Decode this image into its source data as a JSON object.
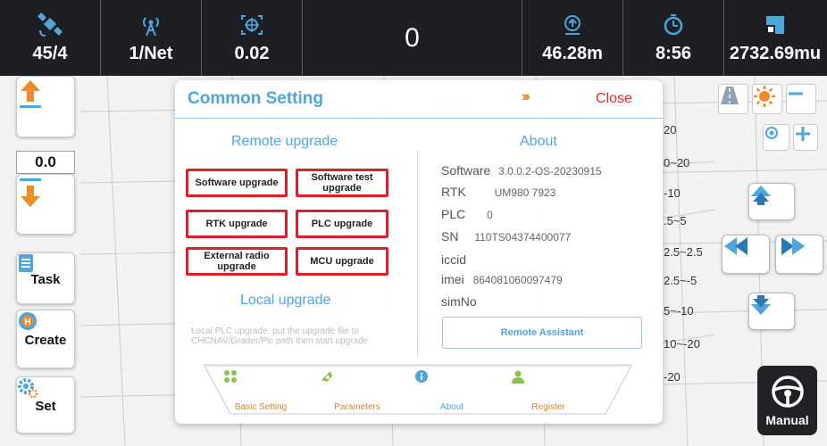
{
  "topbar": {
    "satellites": "45/4",
    "signal": "1/Net",
    "precision": "0.02",
    "center_value": "0",
    "distance": "46.28m",
    "time": "8:56",
    "area": "2732.69mu"
  },
  "left_toolbar": {
    "height_value": "0.0",
    "task_label": "Task",
    "create_label": "Create",
    "set_label": "Set"
  },
  "map_labels": [
    "20",
    "0~20",
    "-10",
    ".5~5",
    "2.5~2.5",
    "2.5~-5",
    "5~-10",
    "10~-20",
    "-20"
  ],
  "right_controls": {
    "manual_label": "Manual"
  },
  "dialog": {
    "title": "Common Setting",
    "arrows": "›››",
    "close_label": "Close",
    "remote_upgrade": {
      "heading": "Remote upgrade",
      "software_upgrade": "Software upgrade",
      "software_test_upgrade": "Software test upgrade",
      "rtk_upgrade": "RTK upgrade",
      "plc_upgrade": "PLC upgrade",
      "external_radio_upgrade": "External radio upgrade",
      "mcu_upgrade": "MCU upgrade"
    },
    "local_upgrade": {
      "heading": "Local upgrade",
      "hint": "Local PLC upgrade: put the upgrade file to CHCNAV/Grader/Plc path then start upgrade"
    },
    "about": {
      "heading": "About",
      "software_key": "Software",
      "software_val": "3.0.0.2-OS-20230915",
      "rtk_key": "RTK",
      "rtk_val": "UM980 7923",
      "plc_key": "PLC",
      "plc_val": "0",
      "sn_key": "SN",
      "sn_val": "110TS04374400077",
      "iccid_key": "iccid",
      "imei_key": "imei",
      "imei_val": "864081060097479",
      "simno_key": "simNo",
      "remote_assistant": "Remote Assistant"
    },
    "tabs": {
      "basic_setting": "Basic Setting",
      "parameters": "Parameters",
      "about": "About",
      "register": "Register"
    }
  },
  "colors": {
    "accent_blue": "#4ea6dc",
    "highlight_red": "#e01e2b",
    "orange": "#ef8b2c",
    "topbar_bg": "#1d1f22"
  }
}
